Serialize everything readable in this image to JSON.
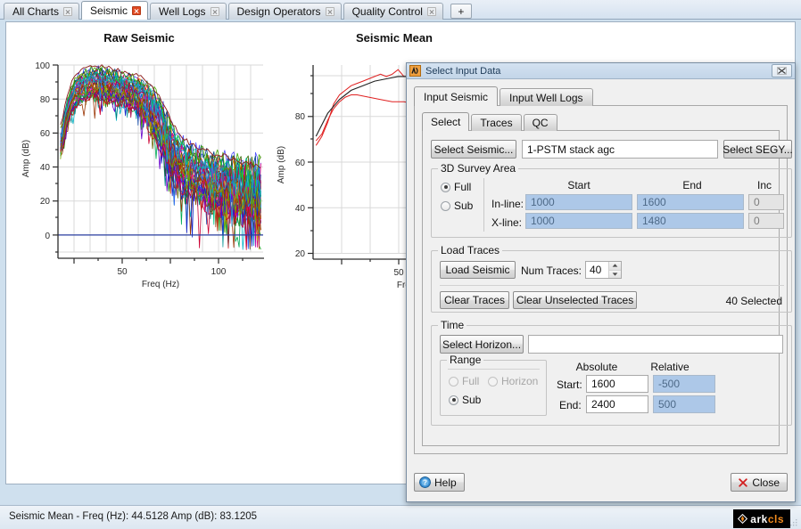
{
  "window": {
    "tabs": [
      {
        "label": "All Charts",
        "active": false,
        "close_icon": "close-icon-gray"
      },
      {
        "label": "Seismic",
        "active": true,
        "close_icon": "close-icon-red"
      },
      {
        "label": "Well Logs",
        "active": false,
        "close_icon": "close-icon-gray"
      },
      {
        "label": "Design Operators",
        "active": false,
        "close_icon": "close-icon-gray"
      },
      {
        "label": "Quality Control",
        "active": false,
        "close_icon": "close-icon-gray"
      }
    ],
    "add_tab_label": "+"
  },
  "status": {
    "text": "Seismic Mean  -  Freq (Hz): 44.5128  Amp (dB): 83.1205",
    "logo_ark": "ark",
    "logo_cls": "cls"
  },
  "dialog": {
    "title": "Select Input Data",
    "title_icon": "app-icon",
    "close_icon": "window-close-icon",
    "outer_tabs": [
      {
        "label": "Input Seismic",
        "active": true
      },
      {
        "label": "Input Well Logs",
        "active": false
      }
    ],
    "inner_tabs": [
      {
        "label": "Select",
        "active": true
      },
      {
        "label": "Traces",
        "active": false
      },
      {
        "label": "QC",
        "active": false
      }
    ],
    "select_seismic_button": "Select Seismic...",
    "seismic_name": "1-PSTM stack agc",
    "select_segy_button": "Select SEGY...",
    "survey": {
      "legend": "3D Survey Area",
      "scope_full": "Full",
      "scope_sub": "Sub",
      "scope_selected": "Full",
      "col_start": "Start",
      "col_end": "End",
      "col_inc": "Inc",
      "rows": [
        {
          "label": "In-line:",
          "start": "1000",
          "end": "1600",
          "inc": "0"
        },
        {
          "label": "X-line:",
          "start": "1000",
          "end": "1480",
          "inc": "0"
        }
      ]
    },
    "load_traces": {
      "legend": "Load Traces",
      "load_seismic_button": "Load Seismic",
      "num_traces_label": "Num Traces:",
      "num_traces_value": "40",
      "clear_traces_button": "Clear Traces",
      "clear_unselected_button": "Clear Unselected Traces",
      "selected_count": "40 Selected"
    },
    "time": {
      "legend": "Time",
      "select_horizon_button": "Select Horizon...",
      "horizon_value": "",
      "range": {
        "legend": "Range",
        "full": "Full",
        "horizon": "Horizon",
        "sub": "Sub",
        "selected": "Sub"
      },
      "col_absolute": "Absolute",
      "col_relative": "Relative",
      "start_label": "Start:",
      "start_absolute": "1600",
      "start_relative": "-500",
      "end_label": "End:",
      "end_absolute": "2400",
      "end_relative": "500"
    },
    "help_button": "Help",
    "help_icon": "help-icon",
    "close_button": "Close",
    "close_button_icon": "red-x-icon"
  },
  "charts": {
    "raw": {
      "title": "Raw Seismic"
    },
    "mean": {
      "title": "Seismic Mean"
    }
  },
  "chart_data": [
    {
      "type": "line",
      "title": "Raw Seismic",
      "xlabel": "Freq (Hz)",
      "ylabel": "Amp (dB)",
      "xlim": [
        0,
        125
      ],
      "ylim": [
        -10,
        100
      ],
      "xticks": [
        50,
        100
      ],
      "yticks": [
        0,
        20,
        40,
        60,
        80,
        100
      ],
      "grid": true,
      "legend": "none",
      "description": "Overlay of 40 individual trace amplitude spectra in many colors, plus a dark blue zero reference line at 0 dB.",
      "series": [
        {
          "name": "trace-envelope-upper",
          "color": "#8b1a1a",
          "x": [
            2,
            6,
            10,
            14,
            18,
            22,
            26,
            30,
            34,
            38,
            42,
            46,
            50,
            54,
            58,
            62,
            66,
            70,
            74,
            78,
            82,
            86,
            90,
            94,
            98,
            102,
            106,
            110,
            114,
            118,
            122
          ],
          "values": [
            64,
            82,
            92,
            96,
            97,
            99,
            98,
            97,
            96,
            95,
            94,
            93,
            92,
            89,
            85,
            80,
            72,
            64,
            58,
            54,
            51,
            50,
            48,
            46,
            45,
            44,
            43,
            41,
            40,
            40,
            38
          ]
        },
        {
          "name": "trace-envelope-mid",
          "color": "#1f5fbf",
          "x": [
            2,
            6,
            10,
            14,
            18,
            22,
            26,
            30,
            34,
            38,
            42,
            46,
            50,
            54,
            58,
            62,
            66,
            70,
            74,
            78,
            82,
            86,
            90,
            94,
            98,
            102,
            106,
            110,
            114,
            118,
            122
          ],
          "values": [
            58,
            76,
            84,
            87,
            88,
            89,
            88,
            87,
            86,
            85,
            84,
            83,
            81,
            76,
            70,
            62,
            54,
            46,
            40,
            36,
            33,
            31,
            29,
            28,
            27,
            26,
            25,
            24,
            24,
            23,
            23
          ]
        },
        {
          "name": "trace-envelope-lower",
          "color": "#157a15",
          "x": [
            2,
            6,
            10,
            14,
            18,
            22,
            26,
            30,
            34,
            38,
            42,
            46,
            50,
            54,
            58,
            62,
            66,
            70,
            74,
            78,
            82,
            86,
            90,
            94,
            98,
            102,
            106,
            110,
            114,
            118,
            122
          ],
          "values": [
            44,
            64,
            72,
            76,
            78,
            79,
            78,
            77,
            76,
            75,
            74,
            72,
            70,
            64,
            57,
            48,
            40,
            32,
            26,
            22,
            19,
            17,
            15,
            14,
            13,
            12,
            11,
            10,
            9,
            8,
            6
          ]
        },
        {
          "name": "zero-line",
          "color": "#2a3fa0",
          "x": [
            0,
            125
          ],
          "values": [
            0,
            0
          ]
        }
      ]
    },
    {
      "type": "line",
      "title": "Seismic Mean",
      "xlabel": "Freq (Hz)",
      "ylabel": "Amp (dB)",
      "xlim": [
        0,
        70
      ],
      "ylim": [
        15,
        97
      ],
      "xticks": [
        50
      ],
      "yticks": [
        20,
        40,
        60,
        80
      ],
      "grid": true,
      "legend": "none",
      "series": [
        {
          "name": "mean-spectrum",
          "color": "#e02020",
          "x": [
            1,
            3,
            5,
            7,
            9,
            11,
            13,
            15,
            17,
            19,
            21,
            23,
            25,
            27,
            29,
            31,
            33,
            35,
            37,
            39,
            41,
            43,
            45,
            47,
            49,
            51,
            53,
            55,
            57,
            59,
            61,
            63,
            65,
            67
          ],
          "values": [
            62,
            66,
            72,
            80,
            84,
            86,
            88,
            89,
            90,
            91,
            92,
            93,
            92,
            93,
            95,
            92,
            92,
            93,
            92,
            91,
            90,
            89,
            89,
            88,
            87,
            86,
            85,
            84,
            82,
            80,
            79,
            78,
            78,
            76
          ]
        },
        {
          "name": "smoothed-fit",
          "color": "#202020",
          "x": [
            1,
            5,
            9,
            13,
            17,
            21,
            25,
            29,
            33,
            37,
            41,
            45,
            49,
            53,
            57,
            61,
            65,
            67
          ],
          "values": [
            66,
            76,
            82,
            86,
            88,
            90,
            91,
            92,
            92,
            92,
            91,
            90,
            88,
            86,
            84,
            81,
            76,
            70
          ]
        },
        {
          "name": "lower-mean",
          "color": "#e02020",
          "x": [
            1,
            3,
            5,
            7,
            9,
            11,
            13,
            15,
            19,
            23,
            27,
            31,
            35,
            39,
            43,
            47,
            51,
            55,
            59,
            63,
            67
          ],
          "values": [
            64,
            67,
            73,
            78,
            81,
            83,
            84,
            84,
            83,
            82,
            81,
            81,
            80,
            80,
            79,
            79,
            79,
            78,
            78,
            77,
            70
          ]
        }
      ]
    }
  ]
}
